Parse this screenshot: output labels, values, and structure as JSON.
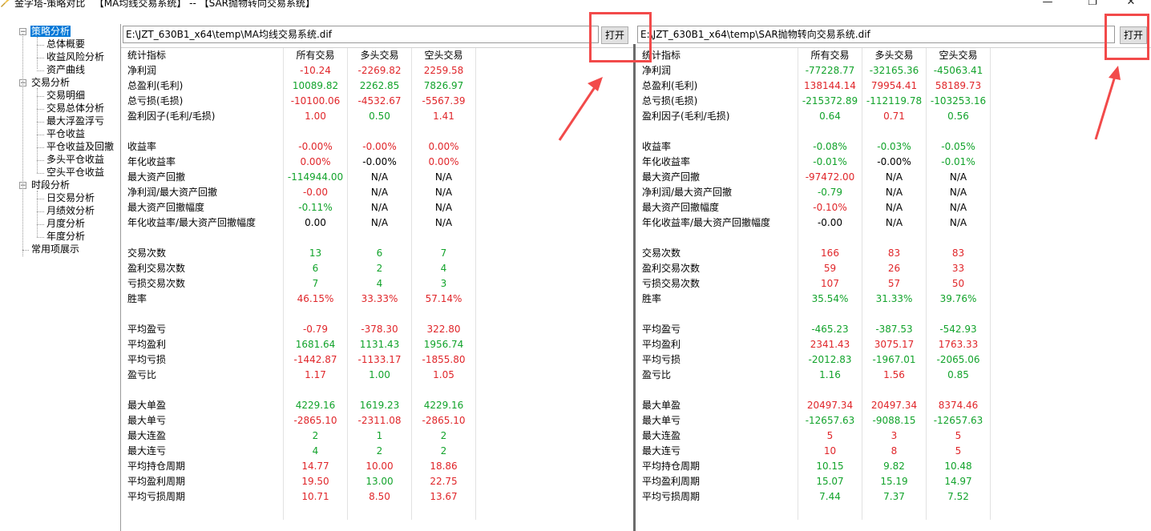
{
  "window": {
    "title": "金字塔-策略对比   【MA均线交易系统】 -- 【SAR抛物转向交易系统】",
    "min": "—",
    "max": "❐",
    "close": "✕"
  },
  "tree": {
    "nodes": [
      {
        "label": "策略分析",
        "level": 0,
        "expander": "−"
      },
      {
        "label": "总体概要",
        "level": 1
      },
      {
        "label": "收益风险分析",
        "level": 1
      },
      {
        "label": "资产曲线",
        "level": 1
      },
      {
        "label": "交易分析",
        "level": 0,
        "expander": "−"
      },
      {
        "label": "交易明细",
        "level": 1
      },
      {
        "label": "交易总体分析",
        "level": 1
      },
      {
        "label": "最大浮盈浮亏",
        "level": 1
      },
      {
        "label": "平仓收益",
        "level": 1
      },
      {
        "label": "平仓收益及回撤",
        "level": 1
      },
      {
        "label": "多头平仓收益",
        "level": 1
      },
      {
        "label": "空头平仓收益",
        "level": 1
      },
      {
        "label": "时段分析",
        "level": 0,
        "expander": "−"
      },
      {
        "label": "日交易分析",
        "level": 1
      },
      {
        "label": "月绩效分析",
        "level": 1
      },
      {
        "label": "月度分析",
        "level": 1
      },
      {
        "label": "年度分析",
        "level": 1
      },
      {
        "label": "常用项展示",
        "level": 0
      }
    ]
  },
  "left": {
    "path": "E:\\JZT_630B1_x64\\temp\\MA均线交易系统.dif",
    "open_label": "打开",
    "headers": [
      "统计指标",
      "所有交易",
      "多头交易",
      "空头交易"
    ],
    "rows": [
      {
        "label": "净利润",
        "vals": [
          "-10.24",
          "-2269.82",
          "2259.58"
        ],
        "c": [
          "pos",
          "pos",
          "pos"
        ]
      },
      {
        "label": "总盈利(毛利)",
        "vals": [
          "10089.82",
          "2262.85",
          "7826.97"
        ],
        "c": [
          "neg",
          "neg",
          "neg"
        ]
      },
      {
        "label": "总亏损(毛损)",
        "vals": [
          "-10100.06",
          "-4532.67",
          "-5567.39"
        ],
        "c": [
          "pos",
          "pos",
          "pos"
        ]
      },
      {
        "label": "盈利因子(毛利/毛损)",
        "vals": [
          "1.00",
          "0.50",
          "1.41"
        ],
        "c": [
          "pos",
          "neg",
          "pos"
        ]
      },
      {
        "label": "",
        "vals": [
          "",
          "",
          ""
        ],
        "c": [
          "neu",
          "neu",
          "neu"
        ]
      },
      {
        "label": "收益率",
        "vals": [
          "-0.00%",
          "-0.00%",
          "0.00%"
        ],
        "c": [
          "pos",
          "pos",
          "pos"
        ]
      },
      {
        "label": "年化收益率",
        "vals": [
          "0.00%",
          "-0.00%",
          "0.00%"
        ],
        "c": [
          "pos",
          "neu",
          "pos"
        ]
      },
      {
        "label": "最大资产回撤",
        "vals": [
          "-114944.00",
          "N/A",
          "N/A"
        ],
        "c": [
          "neg",
          "neu",
          "neu"
        ]
      },
      {
        "label": "净利润/最大资产回撤",
        "vals": [
          "-0.00",
          "N/A",
          "N/A"
        ],
        "c": [
          "pos",
          "neu",
          "neu"
        ]
      },
      {
        "label": "最大资产回撤幅度",
        "vals": [
          "-0.11%",
          "N/A",
          "N/A"
        ],
        "c": [
          "neg",
          "neu",
          "neu"
        ]
      },
      {
        "label": "年化收益率/最大资产回撤幅度",
        "vals": [
          "0.00",
          "N/A",
          "N/A"
        ],
        "c": [
          "neu",
          "neu",
          "neu"
        ]
      },
      {
        "label": "",
        "vals": [
          "",
          "",
          ""
        ],
        "c": [
          "neu",
          "neu",
          "neu"
        ]
      },
      {
        "label": "交易次数",
        "vals": [
          "13",
          "6",
          "7"
        ],
        "c": [
          "neg",
          "neg",
          "neg"
        ]
      },
      {
        "label": "盈利交易次数",
        "vals": [
          "6",
          "2",
          "4"
        ],
        "c": [
          "neg",
          "neg",
          "neg"
        ]
      },
      {
        "label": "亏损交易次数",
        "vals": [
          "7",
          "4",
          "3"
        ],
        "c": [
          "neg",
          "neg",
          "neg"
        ]
      },
      {
        "label": "胜率",
        "vals": [
          "46.15%",
          "33.33%",
          "57.14%"
        ],
        "c": [
          "pos",
          "pos",
          "pos"
        ]
      },
      {
        "label": "",
        "vals": [
          "",
          "",
          ""
        ],
        "c": [
          "neu",
          "neu",
          "neu"
        ]
      },
      {
        "label": "平均盈亏",
        "vals": [
          "-0.79",
          "-378.30",
          "322.80"
        ],
        "c": [
          "pos",
          "pos",
          "pos"
        ]
      },
      {
        "label": "平均盈利",
        "vals": [
          "1681.64",
          "1131.43",
          "1956.74"
        ],
        "c": [
          "neg",
          "neg",
          "neg"
        ]
      },
      {
        "label": "平均亏损",
        "vals": [
          "-1442.87",
          "-1133.17",
          "-1855.80"
        ],
        "c": [
          "pos",
          "pos",
          "pos"
        ]
      },
      {
        "label": "盈亏比",
        "vals": [
          "1.17",
          "1.00",
          "1.05"
        ],
        "c": [
          "pos",
          "neg",
          "pos"
        ]
      },
      {
        "label": "",
        "vals": [
          "",
          "",
          ""
        ],
        "c": [
          "neu",
          "neu",
          "neu"
        ]
      },
      {
        "label": "最大单盈",
        "vals": [
          "4229.16",
          "1619.23",
          "4229.16"
        ],
        "c": [
          "neg",
          "neg",
          "neg"
        ]
      },
      {
        "label": "最大单亏",
        "vals": [
          "-2865.10",
          "-2311.08",
          "-2865.10"
        ],
        "c": [
          "pos",
          "pos",
          "pos"
        ]
      },
      {
        "label": "最大连盈",
        "vals": [
          "2",
          "1",
          "2"
        ],
        "c": [
          "neg",
          "neg",
          "neg"
        ]
      },
      {
        "label": "最大连亏",
        "vals": [
          "4",
          "2",
          "2"
        ],
        "c": [
          "neg",
          "neg",
          "neg"
        ]
      },
      {
        "label": "平均持仓周期",
        "vals": [
          "14.77",
          "10.00",
          "18.86"
        ],
        "c": [
          "pos",
          "pos",
          "pos"
        ]
      },
      {
        "label": "平均盈利周期",
        "vals": [
          "19.50",
          "13.00",
          "22.75"
        ],
        "c": [
          "pos",
          "neg",
          "pos"
        ]
      },
      {
        "label": "平均亏损周期",
        "vals": [
          "10.71",
          "8.50",
          "13.67"
        ],
        "c": [
          "pos",
          "pos",
          "pos"
        ]
      },
      {
        "label": "",
        "vals": [
          "",
          "",
          ""
        ],
        "c": [
          "neu",
          "neu",
          "neu"
        ]
      }
    ]
  },
  "right": {
    "path": "E:\\JZT_630B1_x64\\temp\\SAR抛物转向交易系统.dif",
    "open_label": "打开",
    "headers": [
      "统计指标",
      "所有交易",
      "多头交易",
      "空头交易"
    ],
    "rows": [
      {
        "label": "净利润",
        "vals": [
          "-77228.77",
          "-32165.36",
          "-45063.41"
        ],
        "c": [
          "neg",
          "neg",
          "neg"
        ]
      },
      {
        "label": "总盈利(毛利)",
        "vals": [
          "138144.14",
          "79954.41",
          "58189.73"
        ],
        "c": [
          "pos",
          "pos",
          "pos"
        ]
      },
      {
        "label": "总亏损(毛损)",
        "vals": [
          "-215372.89",
          "-112119.78",
          "-103253.16"
        ],
        "c": [
          "neg",
          "neg",
          "neg"
        ]
      },
      {
        "label": "盈利因子(毛利/毛损)",
        "vals": [
          "0.64",
          "0.71",
          "0.56"
        ],
        "c": [
          "neg",
          "pos",
          "neg"
        ]
      },
      {
        "label": "",
        "vals": [
          "",
          "",
          ""
        ],
        "c": [
          "neu",
          "neu",
          "neu"
        ]
      },
      {
        "label": "收益率",
        "vals": [
          "-0.08%",
          "-0.03%",
          "-0.05%"
        ],
        "c": [
          "neg",
          "neg",
          "neg"
        ]
      },
      {
        "label": "年化收益率",
        "vals": [
          "-0.01%",
          "-0.00%",
          "-0.01%"
        ],
        "c": [
          "neg",
          "neu",
          "neg"
        ]
      },
      {
        "label": "最大资产回撤",
        "vals": [
          "-97472.00",
          "N/A",
          "N/A"
        ],
        "c": [
          "pos",
          "neu",
          "neu"
        ]
      },
      {
        "label": "净利润/最大资产回撤",
        "vals": [
          "-0.79",
          "N/A",
          "N/A"
        ],
        "c": [
          "neg",
          "neu",
          "neu"
        ]
      },
      {
        "label": "最大资产回撤幅度",
        "vals": [
          "-0.10%",
          "N/A",
          "N/A"
        ],
        "c": [
          "pos",
          "neu",
          "neu"
        ]
      },
      {
        "label": "年化收益率/最大资产回撤幅度",
        "vals": [
          "-0.00",
          "N/A",
          "N/A"
        ],
        "c": [
          "neu",
          "neu",
          "neu"
        ]
      },
      {
        "label": "",
        "vals": [
          "",
          "",
          ""
        ],
        "c": [
          "neu",
          "neu",
          "neu"
        ]
      },
      {
        "label": "交易次数",
        "vals": [
          "166",
          "83",
          "83"
        ],
        "c": [
          "pos",
          "pos",
          "pos"
        ]
      },
      {
        "label": "盈利交易次数",
        "vals": [
          "59",
          "26",
          "33"
        ],
        "c": [
          "pos",
          "pos",
          "pos"
        ]
      },
      {
        "label": "亏损交易次数",
        "vals": [
          "107",
          "57",
          "50"
        ],
        "c": [
          "pos",
          "pos",
          "pos"
        ]
      },
      {
        "label": "胜率",
        "vals": [
          "35.54%",
          "31.33%",
          "39.76%"
        ],
        "c": [
          "neg",
          "neg",
          "neg"
        ]
      },
      {
        "label": "",
        "vals": [
          "",
          "",
          ""
        ],
        "c": [
          "neu",
          "neu",
          "neu"
        ]
      },
      {
        "label": "平均盈亏",
        "vals": [
          "-465.23",
          "-387.53",
          "-542.93"
        ],
        "c": [
          "neg",
          "neg",
          "neg"
        ]
      },
      {
        "label": "平均盈利",
        "vals": [
          "2341.43",
          "3075.17",
          "1763.33"
        ],
        "c": [
          "pos",
          "pos",
          "pos"
        ]
      },
      {
        "label": "平均亏损",
        "vals": [
          "-2012.83",
          "-1967.01",
          "-2065.06"
        ],
        "c": [
          "neg",
          "neg",
          "neg"
        ]
      },
      {
        "label": "盈亏比",
        "vals": [
          "1.16",
          "1.56",
          "0.85"
        ],
        "c": [
          "neg",
          "pos",
          "neg"
        ]
      },
      {
        "label": "",
        "vals": [
          "",
          "",
          ""
        ],
        "c": [
          "neu",
          "neu",
          "neu"
        ]
      },
      {
        "label": "最大单盈",
        "vals": [
          "20497.34",
          "20497.34",
          "8374.46"
        ],
        "c": [
          "pos",
          "pos",
          "pos"
        ]
      },
      {
        "label": "最大单亏",
        "vals": [
          "-12657.63",
          "-9088.15",
          "-12657.63"
        ],
        "c": [
          "neg",
          "neg",
          "neg"
        ]
      },
      {
        "label": "最大连盈",
        "vals": [
          "5",
          "3",
          "5"
        ],
        "c": [
          "pos",
          "pos",
          "pos"
        ]
      },
      {
        "label": "最大连亏",
        "vals": [
          "10",
          "8",
          "5"
        ],
        "c": [
          "pos",
          "pos",
          "pos"
        ]
      },
      {
        "label": "平均持仓周期",
        "vals": [
          "10.15",
          "9.82",
          "10.48"
        ],
        "c": [
          "neg",
          "neg",
          "neg"
        ]
      },
      {
        "label": "平均盈利周期",
        "vals": [
          "15.07",
          "15.19",
          "14.97"
        ],
        "c": [
          "neg",
          "neg",
          "neg"
        ]
      },
      {
        "label": "平均亏损周期",
        "vals": [
          "7.44",
          "7.37",
          "7.52"
        ],
        "c": [
          "neg",
          "neg",
          "neg"
        ]
      },
      {
        "label": "",
        "vals": [
          "",
          "",
          ""
        ],
        "c": [
          "neu",
          "neu",
          "neu"
        ]
      }
    ]
  },
  "colors": {
    "positive": "#e0262a",
    "negative": "#12a32b",
    "annotation": "#f24a4a",
    "selection": "#0078d7"
  }
}
